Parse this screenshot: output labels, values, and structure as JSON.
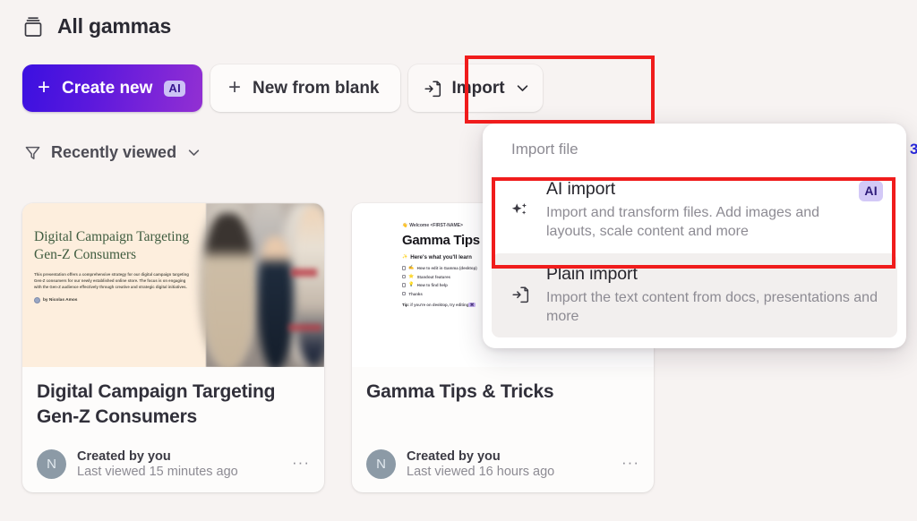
{
  "header": {
    "icon": "archive-box-icon",
    "title": "All gammas"
  },
  "toolbar": {
    "create_new": {
      "label": "Create new",
      "plus": "+",
      "badge": "AI",
      "gradient_from": "#3b10e0",
      "gradient_to": "#9230d2"
    },
    "new_from_blank": {
      "label": "New from blank",
      "plus": "+"
    },
    "import": {
      "label": "Import",
      "icon": "import-file-icon",
      "chevron": "chevron-down-icon",
      "highlighted": true
    }
  },
  "filter": {
    "icon": "funnel-icon",
    "label": "Recently viewed",
    "chevron": "chevron-down-icon"
  },
  "dropdown": {
    "header": "Import file",
    "items": [
      {
        "icon": "sparkles-icon",
        "title": "AI import",
        "description": "Import and transform files. Add images and layouts, scale content and more",
        "badge": "AI",
        "highlighted": true,
        "hovered": false
      },
      {
        "icon": "import-file-icon",
        "title": "Plain import",
        "description": "Import the text content from docs, presentations and more",
        "badge": "",
        "highlighted": false,
        "hovered": true
      }
    ]
  },
  "cards": [
    {
      "title": "Digital Campaign Targeting Gen-Z Consumers",
      "created_by": "Created by you",
      "last_viewed": "Last viewed 15 minutes ago",
      "avatar_initial": "N",
      "menu": "···",
      "thumbnail": {
        "kind": "cream-text-and-photo",
        "heading": "Digital Campaign Targeting Gen-Z Consumers",
        "body": "This presentation offers a comprehensive strategy for our digital campaign targeting Gen-Z consumers for our newly established online store. The focus is on engaging with the Gen-Z audience effectively through creative and strategic digital initiatives.",
        "author": "by Nicolas Amos",
        "bg_color": "#fdeedd",
        "heading_color": "#3f5c3f"
      }
    },
    {
      "title": "Gamma Tips & Tricks",
      "created_by": "Created by you",
      "last_viewed": "Last viewed 16 hours ago",
      "avatar_initial": "N",
      "menu": "···",
      "thumbnail": {
        "kind": "white-doc",
        "welcome": "Welcome <FIRST-NAME>",
        "heading": "Gamma Tips",
        "subheading": "Here's what you'll learn",
        "checklist": [
          "How to edit in Gamma (desktop)",
          "Standout features",
          "How to find help",
          "Thanks"
        ],
        "tip_prefix": "Tip:",
        "tip_text": " if you're on desktop, try editing",
        "tip_key": "⌘",
        "bg_color": "#ffffff"
      }
    }
  ],
  "edge_sliver": "3",
  "annotations": {
    "highlight_color": "#f01c1c"
  }
}
